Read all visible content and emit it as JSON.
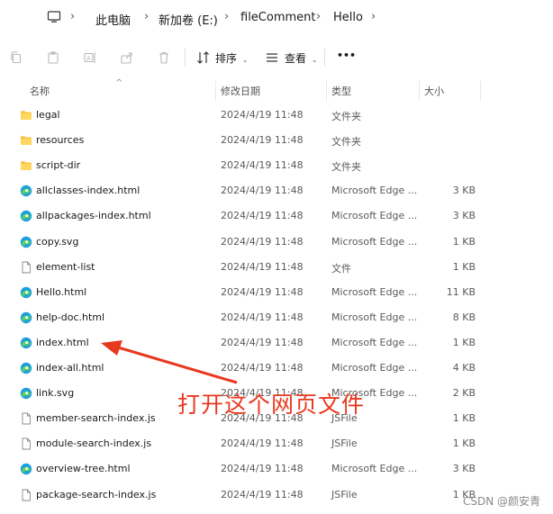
{
  "address_bar": {
    "crumbs": [
      "此电脑",
      "新加卷 (E:)",
      "fileComment",
      "Hello"
    ]
  },
  "toolbar": {
    "sort_label": "排序",
    "view_label": "查看",
    "more_label": "•••"
  },
  "columns": {
    "name": "名称",
    "date": "修改日期",
    "type": "类型",
    "size": "大小"
  },
  "files": [
    {
      "name": "legal",
      "date": "2024/4/19 11:48",
      "type": "文件夹",
      "size": "",
      "icon": "folder-icon"
    },
    {
      "name": "resources",
      "date": "2024/4/19 11:48",
      "type": "文件夹",
      "size": "",
      "icon": "folder-icon"
    },
    {
      "name": "script-dir",
      "date": "2024/4/19 11:48",
      "type": "文件夹",
      "size": "",
      "icon": "folder-icon"
    },
    {
      "name": "allclasses-index.html",
      "date": "2024/4/19 11:48",
      "type": "Microsoft Edge ...",
      "size": "3 KB",
      "icon": "edge-icon"
    },
    {
      "name": "allpackages-index.html",
      "date": "2024/4/19 11:48",
      "type": "Microsoft Edge ...",
      "size": "3 KB",
      "icon": "edge-icon"
    },
    {
      "name": "copy.svg",
      "date": "2024/4/19 11:48",
      "type": "Microsoft Edge ...",
      "size": "1 KB",
      "icon": "edge-icon"
    },
    {
      "name": "element-list",
      "date": "2024/4/19 11:48",
      "type": "文件",
      "size": "1 KB",
      "icon": "file-icon"
    },
    {
      "name": "Hello.html",
      "date": "2024/4/19 11:48",
      "type": "Microsoft Edge ...",
      "size": "11 KB",
      "icon": "edge-icon"
    },
    {
      "name": "help-doc.html",
      "date": "2024/4/19 11:48",
      "type": "Microsoft Edge ...",
      "size": "8 KB",
      "icon": "edge-icon"
    },
    {
      "name": "index.html",
      "date": "2024/4/19 11:48",
      "type": "Microsoft Edge ...",
      "size": "1 KB",
      "icon": "edge-icon"
    },
    {
      "name": "index-all.html",
      "date": "2024/4/19 11:48",
      "type": "Microsoft Edge ...",
      "size": "4 KB",
      "icon": "edge-icon"
    },
    {
      "name": "link.svg",
      "date": "2024/4/19 11:48",
      "type": "Microsoft Edge ...",
      "size": "2 KB",
      "icon": "edge-icon"
    },
    {
      "name": "member-search-index.js",
      "date": "2024/4/19 11:48",
      "type": "JSFile",
      "size": "1 KB",
      "icon": "file-icon"
    },
    {
      "name": "module-search-index.js",
      "date": "2024/4/19 11:48",
      "type": "JSFile",
      "size": "1 KB",
      "icon": "file-icon"
    },
    {
      "name": "overview-tree.html",
      "date": "2024/4/19 11:48",
      "type": "Microsoft Edge ...",
      "size": "3 KB",
      "icon": "edge-icon"
    },
    {
      "name": "package-search-index.js",
      "date": "2024/4/19 11:48",
      "type": "JSFile",
      "size": "1 KB",
      "icon": "file-icon"
    }
  ],
  "annotation": {
    "text": "打开这个网页文件",
    "color": "#e8391f"
  },
  "watermark": "CSDN @颜安青"
}
